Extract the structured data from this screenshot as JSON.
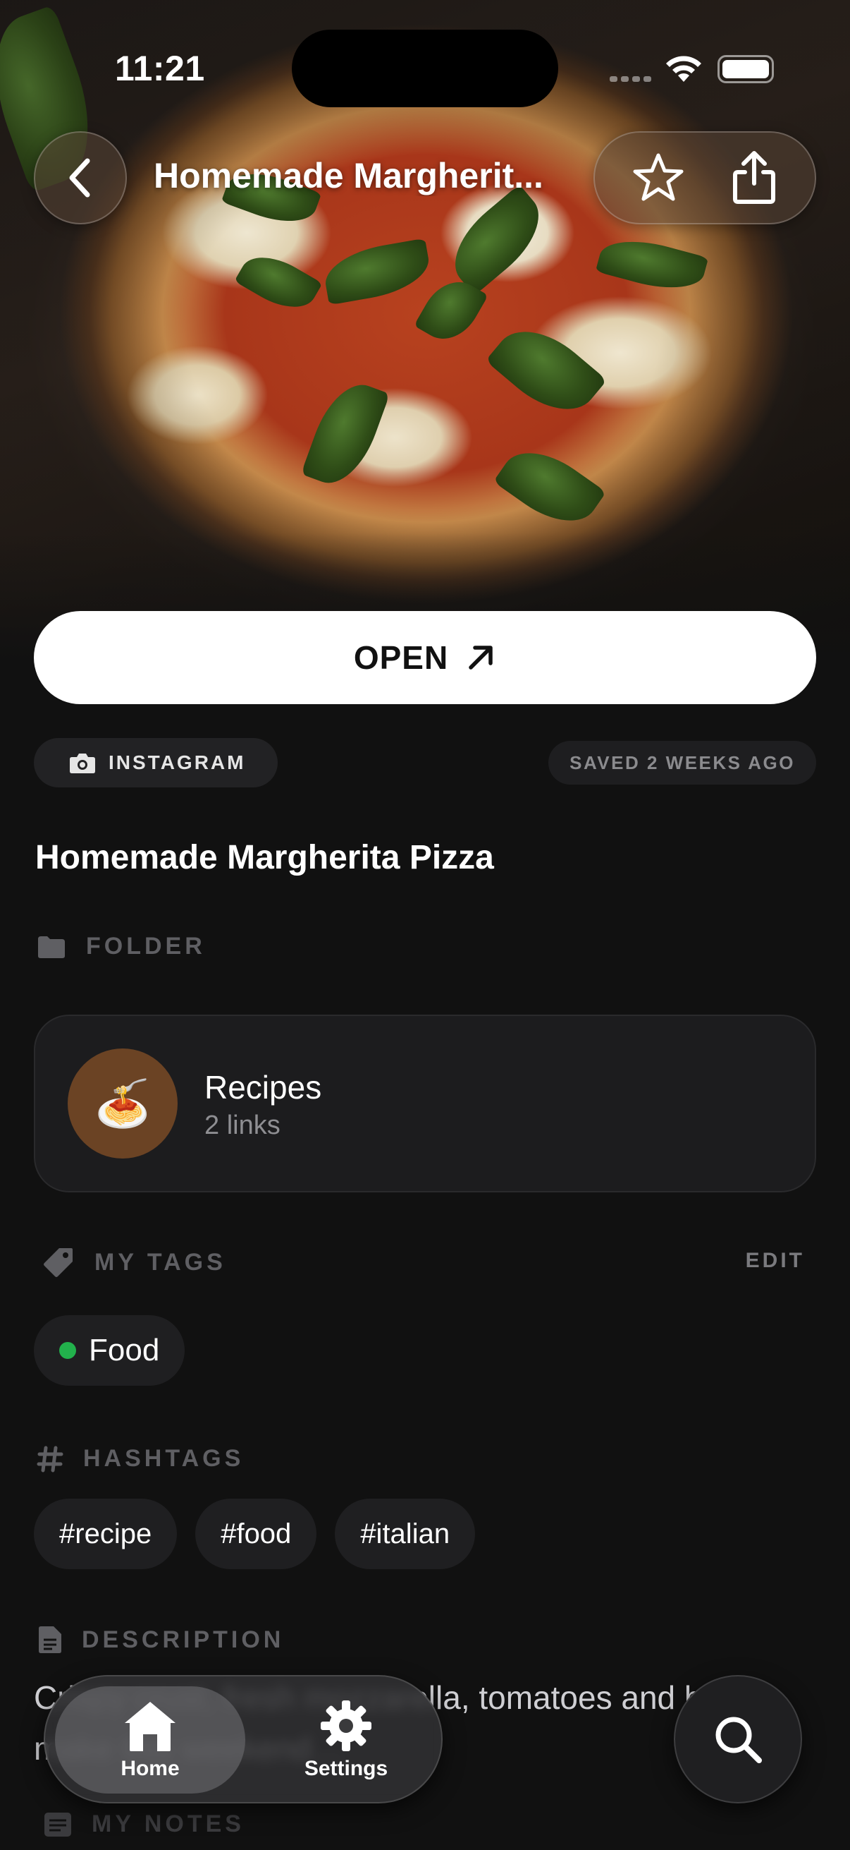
{
  "status_bar": {
    "time": "11:21"
  },
  "nav": {
    "title": "Homemade Margherit...",
    "back_icon": "chevron-left-icon",
    "favorite_icon": "star-icon",
    "share_icon": "share-icon"
  },
  "open_button": {
    "label": "OPEN",
    "icon": "arrow-up-right-icon"
  },
  "meta": {
    "source": "INSTAGRAM",
    "source_icon": "camera-icon",
    "saved": "SAVED 2 WEEKS AGO"
  },
  "title": "Homemade Margherita Pizza",
  "folder_section": {
    "heading": "FOLDER",
    "folder": {
      "name": "Recipes",
      "count": "2 links",
      "emoji": "🍝"
    }
  },
  "tags_section": {
    "heading": "MY TAGS",
    "edit": "EDIT",
    "tags": [
      {
        "label": "Food",
        "color": "#22b14c"
      }
    ]
  },
  "hashtags_section": {
    "heading": "HASHTAGS",
    "hashtags": [
      "#recipe",
      "#food",
      "#italian"
    ]
  },
  "description_section": {
    "heading": "DESCRIPTION",
    "text": "Crispy crust, fresh mozzarella, tomatoes and basil make this weekend…"
  },
  "notes_section": {
    "heading": "MY NOTES"
  },
  "tab_bar": {
    "tabs": [
      {
        "label": "Home",
        "icon": "house-icon"
      },
      {
        "label": "Settings",
        "icon": "gear-icon"
      }
    ],
    "search_icon": "search-icon"
  },
  "colors": {
    "background": "#111111",
    "card": "#1c1c1e",
    "accent_tag": "#22b14c"
  }
}
